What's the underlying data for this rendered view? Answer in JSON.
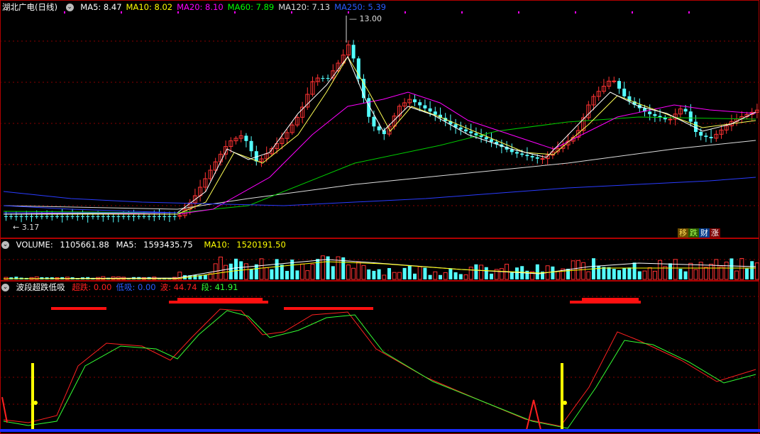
{
  "main": {
    "stock_name": "湖北广电",
    "period": "(日线)",
    "ma": [
      {
        "label": "MA5:",
        "value": "8.47",
        "color": "#ffffff"
      },
      {
        "label": "MA10:",
        "value": "8.02",
        "color": "#ffff00"
      },
      {
        "label": "MA20:",
        "value": "8.10",
        "color": "#ff00ff"
      },
      {
        "label": "MA60:",
        "value": "7.89",
        "color": "#00ff00"
      },
      {
        "label": "MA120:",
        "value": "7.13",
        "color": "#dddddd"
      },
      {
        "label": "MA250:",
        "value": "5.39",
        "color": "#2a5cff"
      }
    ],
    "high_label": "13.00",
    "low_label": "3.17",
    "badges": [
      "移",
      "跌",
      "财",
      "涨"
    ]
  },
  "volume": {
    "label": "VOLUME:",
    "value": "1105661.88",
    "ma5_label": "MA5:",
    "ma5_value": "1593435.75",
    "ma10_label": "MA10:",
    "ma10_value": "1520191.50"
  },
  "indicator": {
    "name": "波段超跌低吸",
    "fields": [
      {
        "label": "超跌:",
        "value": "0.00",
        "color": "#ff2020"
      },
      {
        "label": "低吸:",
        "value": "0.00",
        "color": "#2a5cff"
      },
      {
        "label": "波:",
        "value": "44.74",
        "color": "#ff2020"
      },
      {
        "label": "段:",
        "value": "41.91",
        "color": "#33ff33"
      }
    ],
    "marker_char": "B"
  },
  "colors": {
    "up": "#ff3232",
    "down": "#54ffff",
    "grid": "#8a0000",
    "border": "#b00000"
  }
}
